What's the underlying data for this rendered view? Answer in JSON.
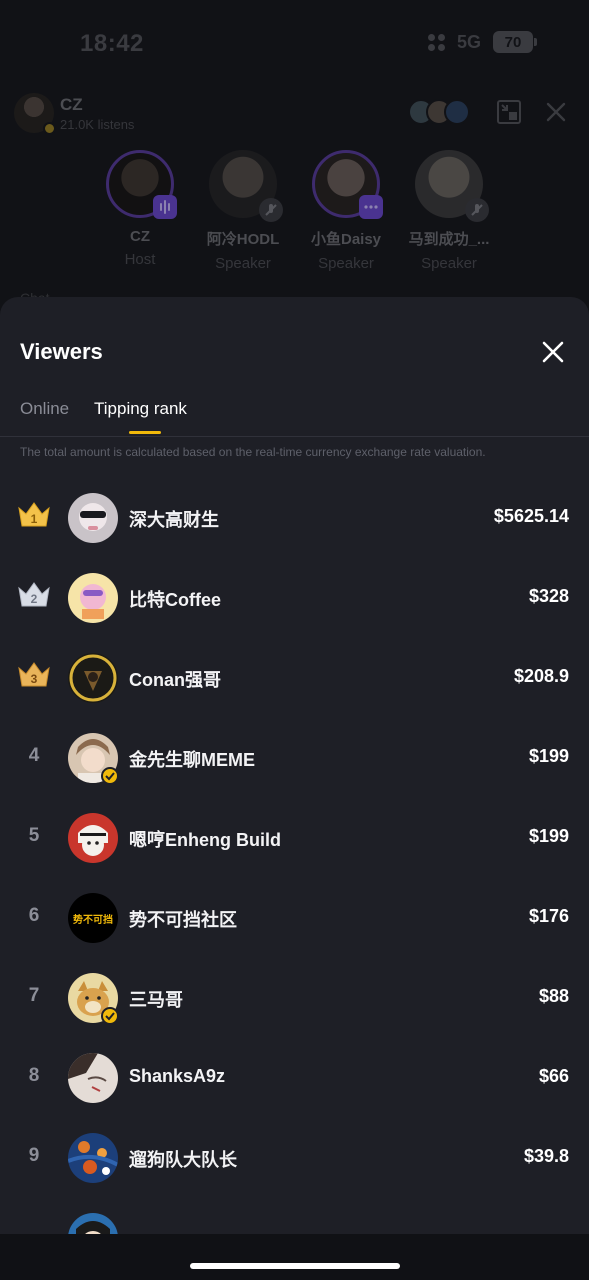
{
  "status_bar": {
    "time": "18:42",
    "network": "5G",
    "battery": "70"
  },
  "room": {
    "host_name": "CZ",
    "listens": "21.0K listens",
    "speakers": [
      {
        "name": "CZ",
        "role": "Host",
        "tag_icon": "audio-wave-icon"
      },
      {
        "name": "阿冷HODL",
        "role": "Speaker",
        "tag_icon": "mic-off-icon"
      },
      {
        "name": "小鱼Daisy",
        "role": "Speaker",
        "tag_icon": "more-icon"
      },
      {
        "name": "马到成功_...",
        "role": "Speaker",
        "tag_icon": "mic-off-icon"
      }
    ],
    "chat_label": "Chat"
  },
  "sheet": {
    "title": "Viewers",
    "tabs": [
      {
        "label": "Online",
        "active": false
      },
      {
        "label": "Tipping rank",
        "active": true
      }
    ],
    "note": "The total amount is calculated based on the real-time currency exchange rate valuation.",
    "accent_color": "#f0b90b",
    "ranking": [
      {
        "rank": "1",
        "name": "深大高财生",
        "amount": "$5625.14",
        "crown": "gold",
        "verified": false
      },
      {
        "rank": "2",
        "name": "比特Coffee",
        "amount": "$328",
        "crown": "silver",
        "verified": false
      },
      {
        "rank": "3",
        "name": "Conan强哥",
        "amount": "$208.9",
        "crown": "bronze",
        "verified": false
      },
      {
        "rank": "4",
        "name": "金先生聊MEME",
        "amount": "$199",
        "crown": null,
        "verified": true
      },
      {
        "rank": "5",
        "name": "嗯哼Enheng Build",
        "amount": "$199",
        "crown": null,
        "verified": false
      },
      {
        "rank": "6",
        "name": "势不可挡社区",
        "amount": "$176",
        "crown": null,
        "verified": false
      },
      {
        "rank": "7",
        "name": "三马哥",
        "amount": "$88",
        "crown": null,
        "verified": true
      },
      {
        "rank": "8",
        "name": "ShanksA9z",
        "amount": "$66",
        "crown": null,
        "verified": false
      },
      {
        "rank": "9",
        "name": "遛狗队大队长",
        "amount": "$39.8",
        "crown": null,
        "verified": false
      }
    ],
    "avatar_text_6": "势不可挡"
  }
}
